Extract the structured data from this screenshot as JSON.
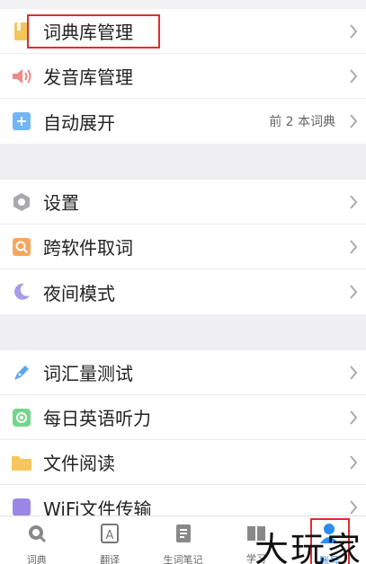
{
  "colors": {
    "accent": "#2a8cf5",
    "highlight": "#e32b2b"
  },
  "group1": [
    {
      "label": "词典库管理",
      "icon": "book-icon",
      "color": "#f3c65d"
    },
    {
      "label": "发音库管理",
      "icon": "speaker-icon",
      "color": "#f08a86"
    },
    {
      "label": "自动展开",
      "value": "前 2 本词典",
      "icon": "plus-icon",
      "color": "#73b6f5"
    }
  ],
  "group2": [
    {
      "label": "设置",
      "icon": "gear-icon",
      "color": "#a9a9ae"
    },
    {
      "label": "跨软件取词",
      "icon": "search-icon",
      "color": "#f6a75f"
    },
    {
      "label": "夜间模式",
      "icon": "moon-icon",
      "color": "#a79ce8"
    }
  ],
  "group3": [
    {
      "label": "词汇量测试",
      "icon": "pen-icon",
      "color": "#5ea5ef"
    },
    {
      "label": "每日英语听力",
      "icon": "radio-icon",
      "color": "#73d68a"
    },
    {
      "label": "文件阅读",
      "icon": "folder-icon",
      "color": "#f6c65d"
    },
    {
      "label": "WiFi文件传输",
      "icon": "wifi-icon",
      "color": "#9b88e6"
    }
  ],
  "tabs": [
    {
      "label": "词典",
      "icon": "dictionary-icon"
    },
    {
      "label": "翻译",
      "icon": "translate-icon"
    },
    {
      "label": "生词笔记",
      "icon": "notes-icon"
    },
    {
      "label": "学习",
      "icon": "study-icon"
    },
    {
      "label": "账号",
      "icon": "account-icon"
    }
  ],
  "watermark": "大玩家"
}
